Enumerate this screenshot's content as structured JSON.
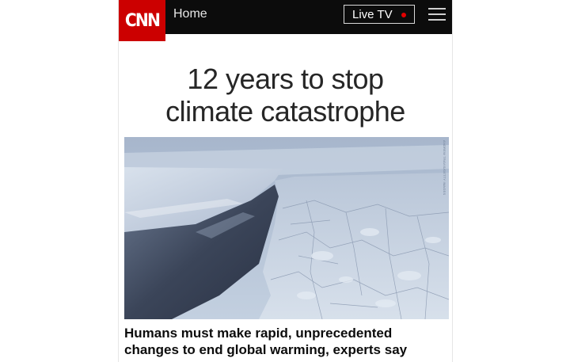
{
  "header": {
    "logo_text": "CNN",
    "home_label": "Home",
    "live_label": "Live TV",
    "icons": [
      "live-indicator-dot",
      "hamburger-menu-icon"
    ]
  },
  "article": {
    "headline_line1": "12 years to stop",
    "headline_line2": "climate catastrophe",
    "image_credit": "ANDREW TRAVIS/GETTY IMAGES",
    "subheadline": "Humans must make rapid, unprecedented changes to end global warming, experts say"
  },
  "colors": {
    "brand_red": "#cc0000",
    "topbar": "#0c0c0c",
    "live_dot": "#e20000",
    "headline": "#262626"
  }
}
